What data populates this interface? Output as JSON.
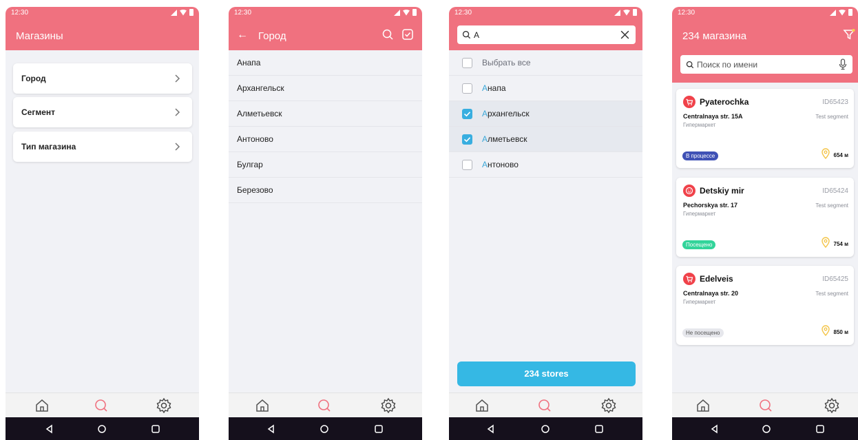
{
  "status": {
    "time": "12:30"
  },
  "screens": {
    "menu": {
      "title": "Магазины",
      "items": [
        {
          "label": "Город"
        },
        {
          "label": "Сегмент"
        },
        {
          "label": "Тип магазина"
        }
      ]
    },
    "city": {
      "title": "Город",
      "cities": [
        "Анапа",
        "Архангельск",
        "Алметьевск",
        "Антоново",
        "Булгар",
        "Березово"
      ]
    },
    "search": {
      "query": "A",
      "select_all": "Выбрать все",
      "highlight": "А",
      "results": [
        {
          "rest": "напа",
          "checked": false
        },
        {
          "rest": "рхангельск",
          "checked": true
        },
        {
          "rest": "лметьевск",
          "checked": true
        },
        {
          "rest": "нтоново",
          "checked": false
        }
      ],
      "button": "234 stores"
    },
    "stores": {
      "title": "234 магазина",
      "search_placeholder": "Поиск по имени",
      "cards": [
        {
          "name": "Pyaterochka",
          "id": "ID65423",
          "address": "Centralnaya str. 15A",
          "type": "Гипермаркет",
          "segment": "Test segment",
          "status": "В процессе",
          "distance": "654 м"
        },
        {
          "name": "Detskiy mir",
          "id": "ID65424",
          "address": "Pechorskya str. 17",
          "type": "Гипермаркет",
          "segment": "Test segment",
          "status": "Посещено",
          "distance": "754 м"
        },
        {
          "name": "Edelveis",
          "id": "ID65425",
          "address": "Centralnaya str. 20",
          "type": "Гипермаркет",
          "segment": "Test segment",
          "status": "Не посещено",
          "distance": "850 м"
        }
      ]
    }
  },
  "colors": {
    "header": "#f0717f",
    "accent_blue": "#35b8e4",
    "status_in_progress": "#3f51b5",
    "status_visited": "#32d49a",
    "status_not_visited": "#e6e7ec"
  },
  "icons": {
    "nav": [
      "home-icon",
      "search-icon",
      "settings-gear-icon"
    ],
    "system": [
      "back-triangle-icon",
      "home-circle-icon",
      "recents-square-icon"
    ]
  }
}
